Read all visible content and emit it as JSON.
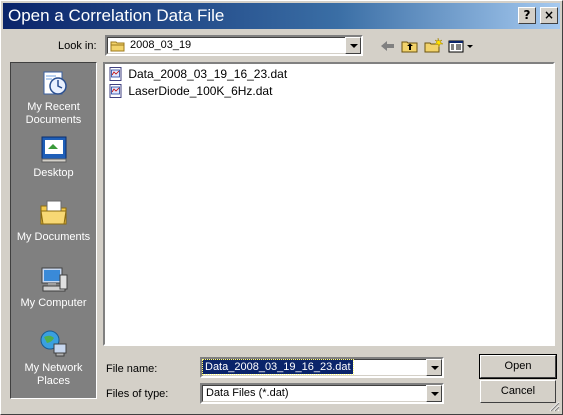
{
  "window": {
    "title": "Open a Correlation Data File"
  },
  "titlebar_buttons": {
    "help": "?",
    "close": "×"
  },
  "look_in": {
    "label": "Look in:",
    "value": "2008_03_19"
  },
  "toolbar": {
    "back_icon": "back-arrow-icon",
    "up_icon": "up-folder-icon",
    "new_folder_icon": "new-folder-icon",
    "views_icon": "views-menu-icon"
  },
  "places": [
    {
      "label": "My Recent Documents",
      "icon": "recent-documents-icon"
    },
    {
      "label": "Desktop",
      "icon": "desktop-icon"
    },
    {
      "label": "My Documents",
      "icon": "my-documents-icon"
    },
    {
      "label": "My Computer",
      "icon": "my-computer-icon"
    },
    {
      "label": "My Network Places",
      "icon": "network-places-icon"
    }
  ],
  "files": [
    {
      "name": "Data_2008_03_19_16_23.dat",
      "icon": "dat-file-icon"
    },
    {
      "name": "LaserDiode_100K_6Hz.dat",
      "icon": "dat-file-icon"
    }
  ],
  "file_name": {
    "label": "File name:",
    "value": "Data_2008_03_19_16_23.dat"
  },
  "file_type": {
    "label": "Files of type:",
    "value": "Data Files (*.dat)"
  },
  "buttons": {
    "open": "Open",
    "cancel": "Cancel"
  },
  "colors": {
    "title_start": "#0a246a",
    "title_end": "#a6caf0",
    "face": "#d4d0c8",
    "places_bg": "#808080",
    "selection": "#0a246a"
  }
}
